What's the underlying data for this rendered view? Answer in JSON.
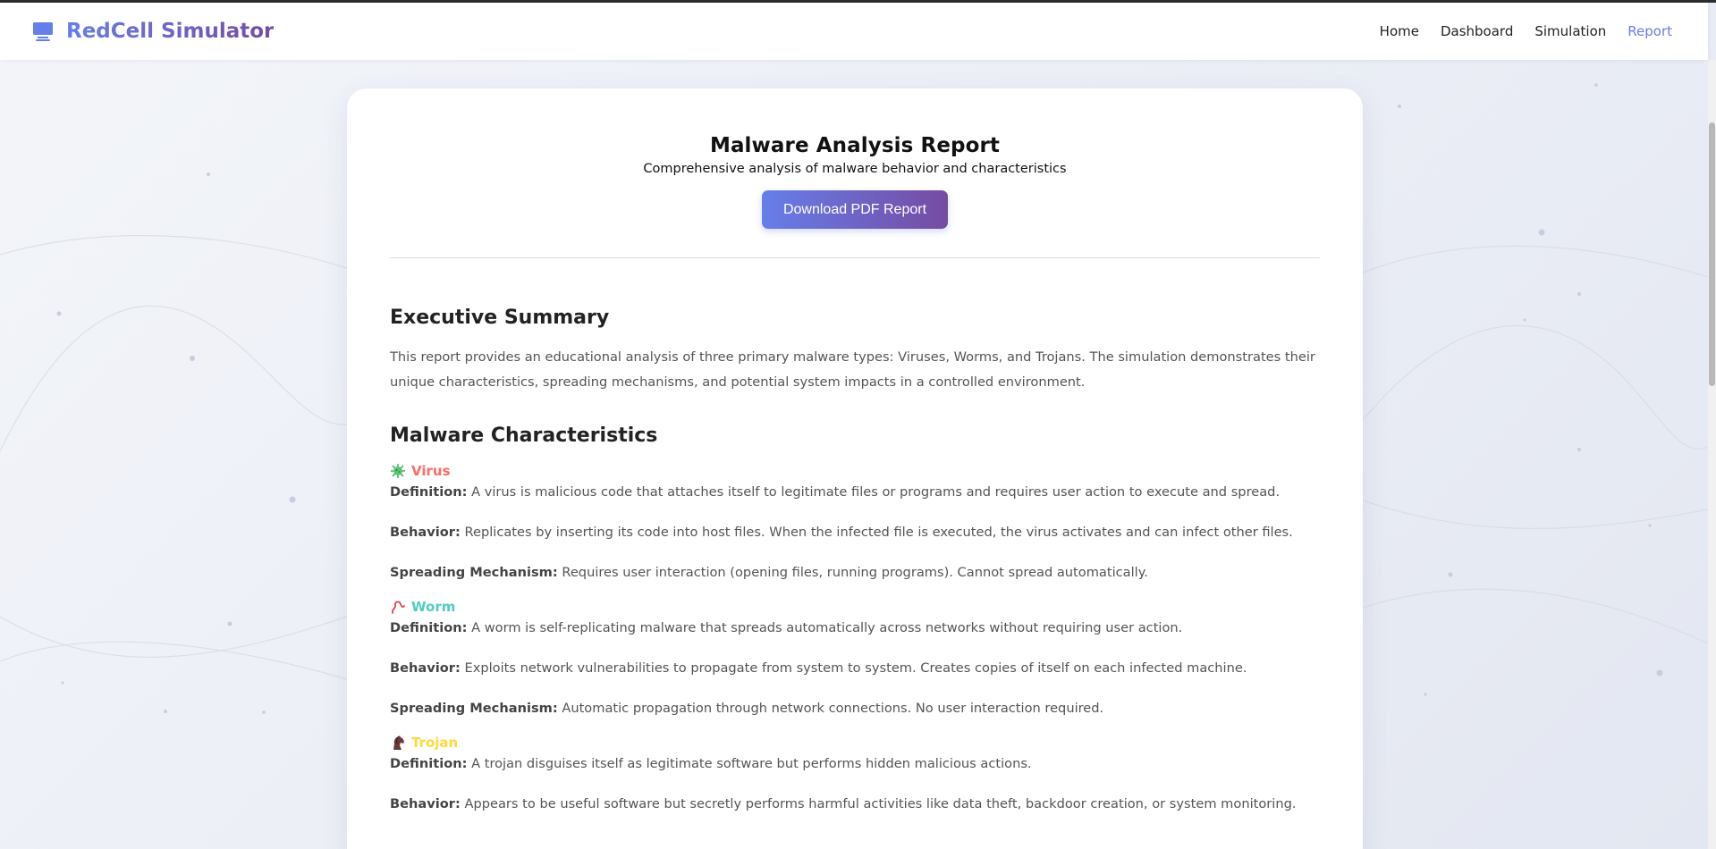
{
  "app": {
    "brand": "RedCell Simulator",
    "brand_icon": "computer-icon",
    "accent": "#667eea",
    "accent2": "#764ba2"
  },
  "nav": {
    "items": [
      {
        "label": "Home"
      },
      {
        "label": "Dashboard"
      },
      {
        "label": "Simulation"
      },
      {
        "label": "Report",
        "active": true
      }
    ]
  },
  "report": {
    "title": "Malware Analysis Report",
    "subtitle": "Comprehensive analysis of malware behavior and characteristics",
    "download_button": "Download PDF Report"
  },
  "summary": {
    "title": "Executive Summary",
    "text": "This report provides an educational analysis of three primary malware types: Viruses, Worms, and Trojans. The simulation demonstrates their unique characteristics, spreading mechanisms, and potential system impacts in a controlled environment."
  },
  "characteristics": {
    "title": "Malware Characteristics",
    "labels": {
      "definition": "Definition:",
      "behavior": "Behavior:",
      "spreading": "Spreading Mechanism:"
    },
    "items": [
      {
        "name": "Virus",
        "icon": "microbe-icon",
        "color": "#ff6b6b",
        "definition": "A virus is malicious code that attaches itself to legitimate files or programs and requires user action to execute and spread.",
        "behavior": "Replicates by inserting its code into host files. When the infected file is executed, the virus activates and can infect other files.",
        "spreading": "Requires user interaction (opening files, running programs). Cannot spread automatically."
      },
      {
        "name": "Worm",
        "icon": "worm-icon",
        "color": "#4ecdc4",
        "definition": "A worm is self-replicating malware that spreads automatically across networks without requiring user action.",
        "behavior": "Exploits network vulnerabilities to propagate from system to system. Creates copies of itself on each infected machine.",
        "spreading": "Automatic propagation through network connections. No user interaction required."
      },
      {
        "name": "Trojan",
        "icon": "horse-icon",
        "color": "#ffd93d",
        "definition": "A trojan disguises itself as legitimate software but performs hidden malicious actions.",
        "behavior": "Appears to be useful software but secretly performs harmful activities like data theft, backdoor creation, or system monitoring."
      }
    ]
  }
}
